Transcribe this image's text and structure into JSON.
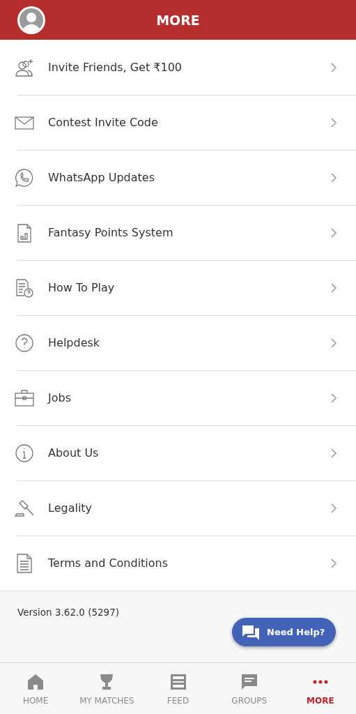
{
  "header": {
    "title": "MORE"
  },
  "menu": [
    {
      "kind": "invite",
      "label": "Invite Friends, Get ₹100"
    },
    {
      "kind": "mail",
      "label": "Contest Invite Code"
    },
    {
      "kind": "chat",
      "label": "WhatsApp Updates"
    },
    {
      "kind": "chart",
      "label": "Fantasy Points System"
    },
    {
      "kind": "guide",
      "label": "How To Play"
    },
    {
      "kind": "help",
      "label": "Helpdesk"
    },
    {
      "kind": "briefcase",
      "label": "Jobs"
    },
    {
      "kind": "info",
      "label": "About Us"
    },
    {
      "kind": "gavel",
      "label": "Legality"
    },
    {
      "kind": "document",
      "label": "Terms and Conditions"
    }
  ],
  "version": "Version 3.62.0 (5297)",
  "help_button": {
    "label": "Need Help?"
  },
  "nav": [
    {
      "kind": "home",
      "label": "HOME",
      "selected": false
    },
    {
      "kind": "trophy",
      "label": "MY MATCHES",
      "selected": false
    },
    {
      "kind": "feed",
      "label": "FEED",
      "selected": false
    },
    {
      "kind": "groups",
      "label": "GROUPS",
      "selected": false
    },
    {
      "kind": "more",
      "label": "MORE",
      "selected": true
    }
  ]
}
